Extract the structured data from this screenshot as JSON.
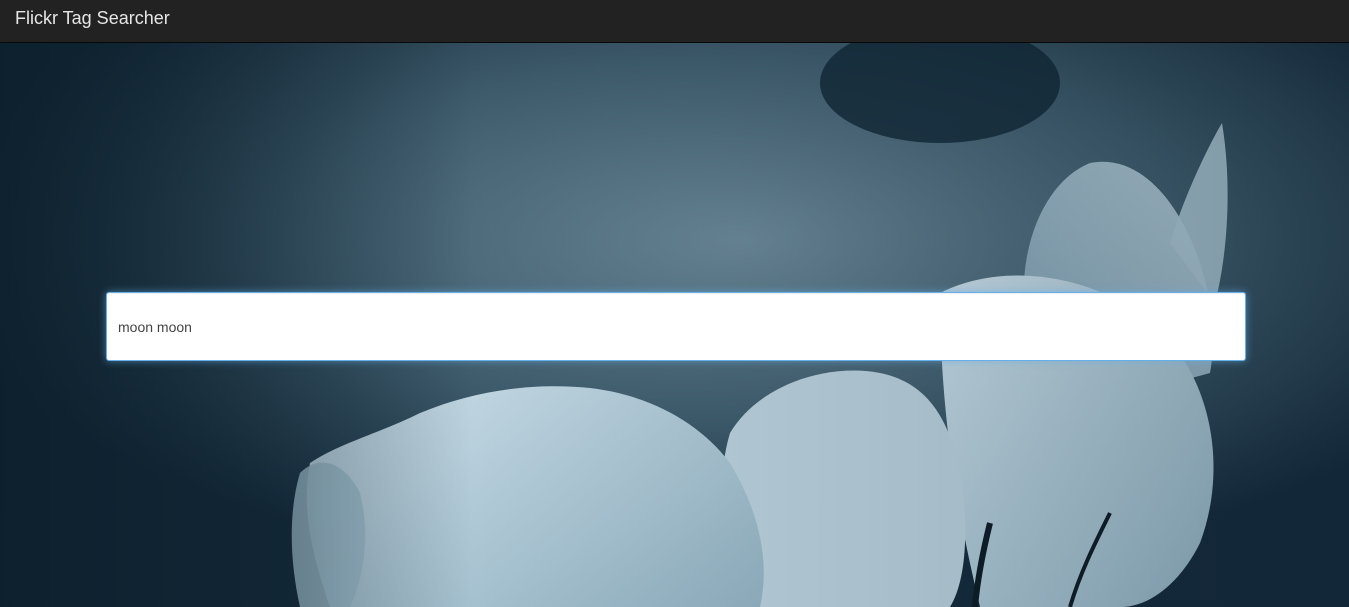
{
  "app": {
    "title": "Flickr Tag Searcher"
  },
  "search": {
    "value": "moon moon",
    "placeholder": ""
  },
  "colors": {
    "navbar_bg": "#222222",
    "brand_text": "#e6e6e6",
    "input_focus_border": "#66afe9",
    "hero_tint": "#1e3441"
  }
}
